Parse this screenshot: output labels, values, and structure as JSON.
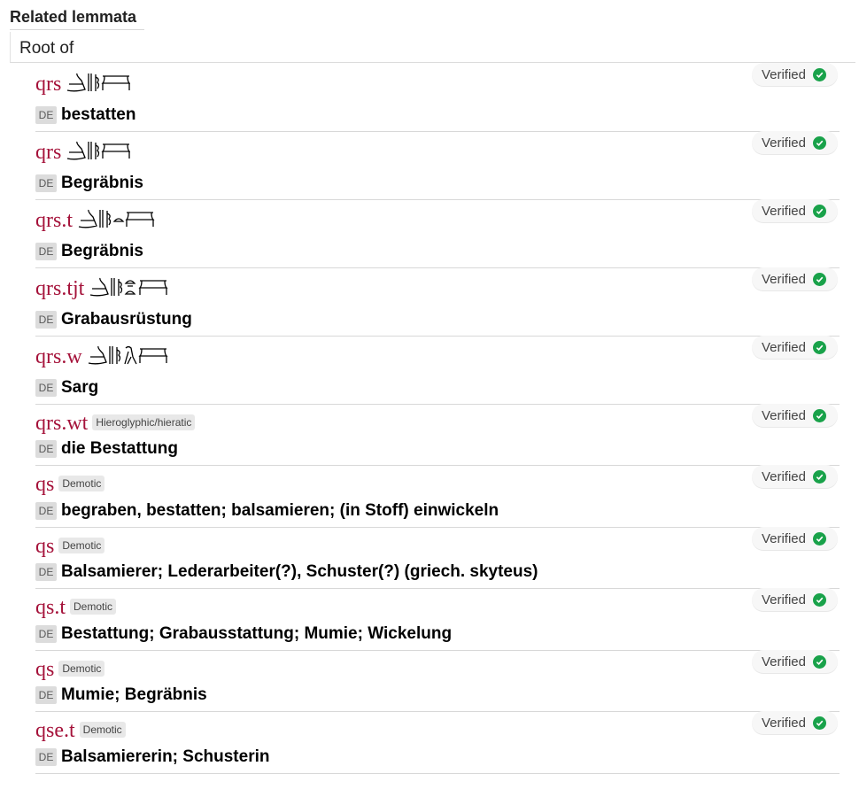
{
  "section_title": "Related lemmata",
  "root_label": "Root of",
  "status_color": "#19a24a",
  "lemma_color": "#a5123a",
  "lemmata": [
    {
      "lemma": "qrs",
      "script": "hieroglyphs",
      "glyph_icon": "hieroglyph-group-qrs",
      "tag": "",
      "lang": "DE",
      "meaning": "bestatten",
      "status": "Verified"
    },
    {
      "lemma": "qrs",
      "script": "hieroglyphs",
      "glyph_icon": "hieroglyph-group-qrs",
      "tag": "",
      "lang": "DE",
      "meaning": "Begräbnis",
      "status": "Verified"
    },
    {
      "lemma": "qrs.t",
      "script": "hieroglyphs",
      "glyph_icon": "hieroglyph-group-qrs-t",
      "tag": "",
      "lang": "DE",
      "meaning": "Begräbnis",
      "status": "Verified"
    },
    {
      "lemma": "qrs.tjt",
      "script": "hieroglyphs",
      "glyph_icon": "hieroglyph-group-qrs-tjt",
      "tag": "",
      "lang": "DE",
      "meaning": "Grabausrüstung",
      "status": "Verified"
    },
    {
      "lemma": "qrs.w",
      "script": "hieroglyphs",
      "glyph_icon": "hieroglyph-group-qrs-w",
      "tag": "",
      "lang": "DE",
      "meaning": "Sarg",
      "status": "Verified"
    },
    {
      "lemma": "qrs.wt",
      "script": "tag",
      "glyph_icon": "",
      "tag": "Hieroglyphic/hieratic",
      "lang": "DE",
      "meaning": "die Bestattung",
      "status": "Verified"
    },
    {
      "lemma": "qs",
      "script": "tag",
      "glyph_icon": "",
      "tag": "Demotic",
      "lang": "DE",
      "meaning": "begraben, bestatten; balsamieren; (in Stoff) einwickeln",
      "status": "Verified"
    },
    {
      "lemma": "qs",
      "script": "tag",
      "glyph_icon": "",
      "tag": "Demotic",
      "lang": "DE",
      "meaning": "Balsamierer; Lederarbeiter(?), Schuster(?) (griech. skyteus)",
      "status": "Verified"
    },
    {
      "lemma": "qs.t",
      "script": "tag",
      "glyph_icon": "",
      "tag": "Demotic",
      "lang": "DE",
      "meaning": "Bestattung; Grabausstattung; Mumie; Wickelung",
      "status": "Verified"
    },
    {
      "lemma": "qs",
      "script": "tag",
      "glyph_icon": "",
      "tag": "Demotic",
      "lang": "DE",
      "meaning": "Mumie; Begräbnis",
      "status": "Verified"
    },
    {
      "lemma": "qse.t",
      "script": "tag",
      "glyph_icon": "",
      "tag": "Demotic",
      "lang": "DE",
      "meaning": "Balsamiererin; Schusterin",
      "status": "Verified"
    }
  ]
}
